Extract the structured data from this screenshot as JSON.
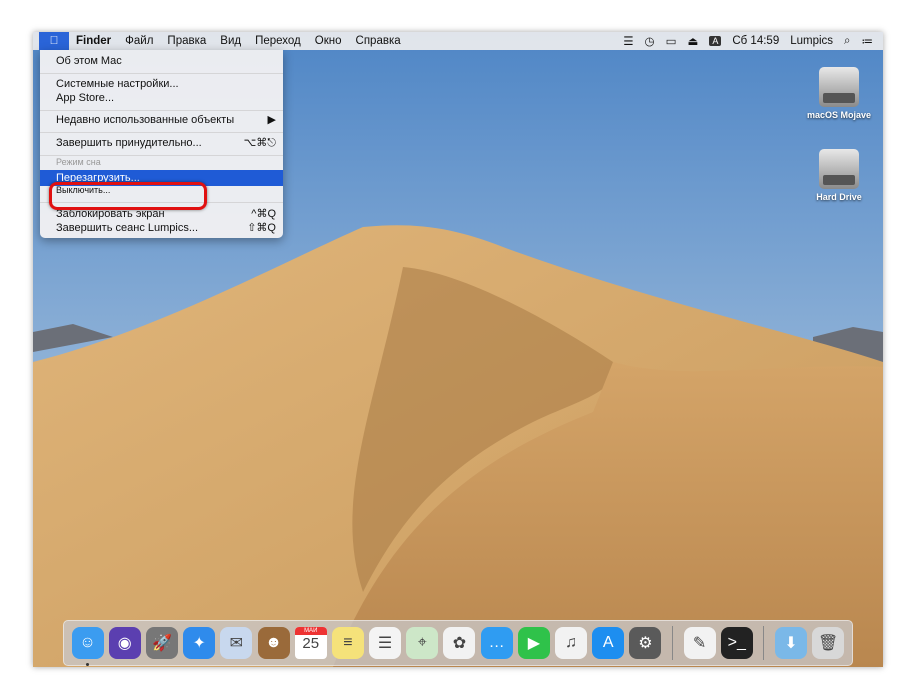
{
  "menubar": {
    "apple_icon": "apple-logo",
    "app": "Finder",
    "items": [
      "Файл",
      "Правка",
      "Вид",
      "Переход",
      "Окно",
      "Справка"
    ],
    "status_icons": [
      "keyboard-brightness-icon",
      "time-machine-icon",
      "airplay-display-icon",
      "eject-icon"
    ],
    "input_source": "A",
    "clock": "Сб 14:59",
    "user": "Lumpics",
    "search_icon": "spotlight-icon",
    "notifications_icon": "notification-center-icon"
  },
  "apple_menu": {
    "items": [
      {
        "label": "Об этом Mac"
      },
      {
        "label": "Системные настройки..."
      },
      {
        "label": "App Store..."
      },
      {
        "label": "Недавно использованные объекты",
        "shortcut": "▶"
      },
      {
        "label": "Завершить принудительно...",
        "shortcut": "⌥⌘⎋"
      },
      {
        "label": "Режим сна"
      },
      {
        "label": "Перезагрузить...",
        "highlighted": true
      },
      {
        "label": "Выключить..."
      },
      {
        "label": "Заблокировать экран",
        "shortcut": "^⌘Q"
      },
      {
        "label": "Завершить сеанс Lumpics...",
        "shortcut": "⇧⌘Q"
      }
    ],
    "highlight_color": "#1f5bd6",
    "annotation_color": "#e01010"
  },
  "desktop": {
    "icons": [
      {
        "label": "macOS Mojave"
      },
      {
        "label": "Hard Drive"
      }
    ]
  },
  "dock": {
    "apps": [
      {
        "name": "Finder",
        "color": "#3b9cf0",
        "glyph": "☺"
      },
      {
        "name": "Siri",
        "color": "#5b3fb0",
        "glyph": "◉"
      },
      {
        "name": "Launchpad",
        "color": "#777",
        "glyph": "🚀"
      },
      {
        "name": "Safari",
        "color": "#2f8bec",
        "glyph": "✦"
      },
      {
        "name": "Mail",
        "color": "#c8d8ee",
        "glyph": "✉"
      },
      {
        "name": "Contacts",
        "color": "#9a6a3a",
        "glyph": "☻"
      },
      {
        "name": "Calendar",
        "color": "#fff",
        "glyph": "25"
      },
      {
        "name": "Notes",
        "color": "#f5e27a",
        "glyph": "≡"
      },
      {
        "name": "Reminders",
        "color": "#f4f4f4",
        "glyph": "☰"
      },
      {
        "name": "Maps",
        "color": "#cde7c8",
        "glyph": "⌖"
      },
      {
        "name": "Photos",
        "color": "#f2f2f2",
        "glyph": "✿"
      },
      {
        "name": "Messages",
        "color": "#2f9cf2",
        "glyph": "…"
      },
      {
        "name": "FaceTime",
        "color": "#2fc24a",
        "glyph": "▶"
      },
      {
        "name": "iTunes",
        "color": "#f2f2f2",
        "glyph": "♫"
      },
      {
        "name": "App Store",
        "color": "#1d8ef0",
        "glyph": "A"
      },
      {
        "name": "System Preferences",
        "color": "#5a5a5a",
        "glyph": "⚙"
      }
    ],
    "utilities": [
      {
        "name": "TextEdit",
        "color": "#f2f2f2",
        "glyph": "✎"
      },
      {
        "name": "Terminal",
        "color": "#222",
        "glyph": ">_"
      }
    ],
    "stacks": [
      {
        "name": "Downloads",
        "color": "#7ab8e8",
        "glyph": "⬇"
      },
      {
        "name": "Trash",
        "color": "#d8d8d8",
        "glyph": "🗑"
      }
    ],
    "calendar_month": "МАЙ"
  }
}
